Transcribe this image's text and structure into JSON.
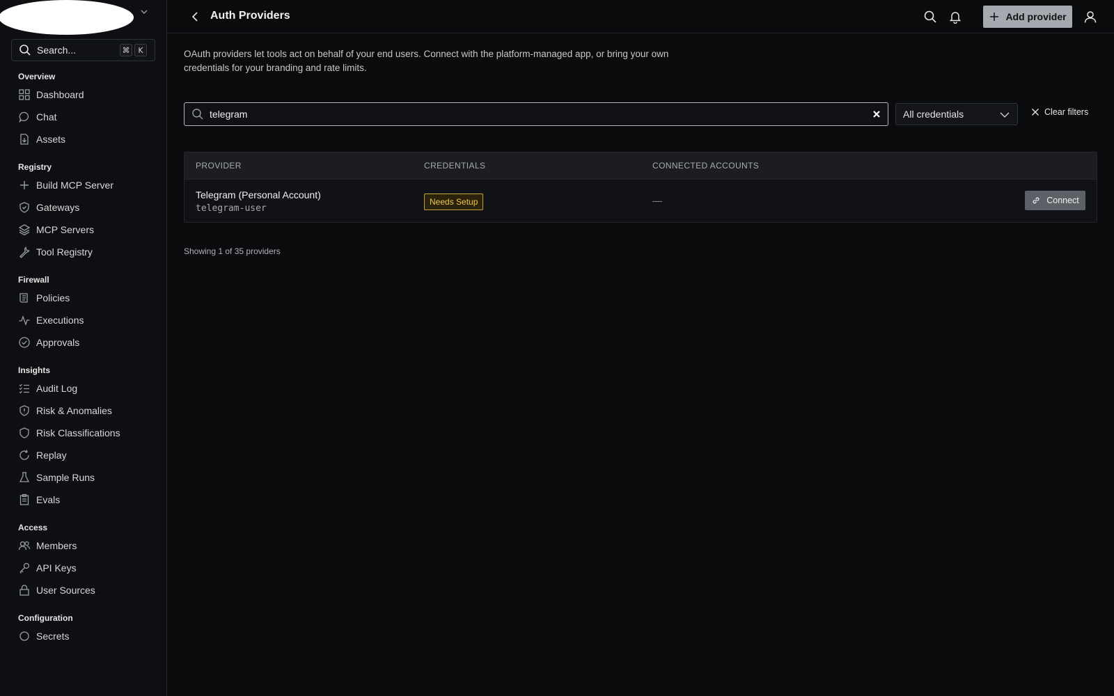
{
  "sidebar": {
    "search_label": "Search...",
    "shortcut_keys": [
      "⌘",
      "K"
    ],
    "sections": [
      {
        "title": "Overview",
        "items": [
          {
            "label": "Dashboard",
            "icon": "grid-icon"
          },
          {
            "label": "Chat",
            "icon": "chat-icon"
          },
          {
            "label": "Assets",
            "icon": "download-icon"
          }
        ]
      },
      {
        "title": "Registry",
        "items": [
          {
            "label": "Build MCP Server",
            "icon": "plus-icon"
          },
          {
            "label": "Gateways",
            "icon": "shield-check-icon"
          },
          {
            "label": "MCP Servers",
            "icon": "layers-icon"
          },
          {
            "label": "Tool Registry",
            "icon": "wrench-icon"
          }
        ]
      },
      {
        "title": "Firewall",
        "items": [
          {
            "label": "Policies",
            "icon": "scroll-icon"
          },
          {
            "label": "Executions",
            "icon": "activity-icon"
          },
          {
            "label": "Approvals",
            "icon": "check-circle-icon"
          }
        ]
      },
      {
        "title": "Insights",
        "items": [
          {
            "label": "Audit Log",
            "icon": "list-check-icon"
          },
          {
            "label": "Risk & Anomalies",
            "icon": "shield-alert-icon"
          },
          {
            "label": "Risk Classifications",
            "icon": "shield-icon"
          },
          {
            "label": "Replay",
            "icon": "refresh-icon"
          },
          {
            "label": "Sample Runs",
            "icon": "flask-icon"
          },
          {
            "label": "Evals",
            "icon": "clipboard-icon"
          }
        ]
      },
      {
        "title": "Access",
        "items": [
          {
            "label": "Members",
            "icon": "users-icon"
          },
          {
            "label": "API Keys",
            "icon": "key-icon"
          },
          {
            "label": "User Sources",
            "icon": "lock-icon"
          }
        ]
      },
      {
        "title": "Configuration",
        "items": [
          {
            "label": "Secrets",
            "icon": "secret-icon"
          }
        ]
      }
    ]
  },
  "header": {
    "title": "Auth Providers",
    "add_label": "Add provider"
  },
  "description": "OAuth providers let tools act on behalf of your end users. Connect with the platform-managed app, or bring your own credentials for your branding and rate limits.",
  "filters": {
    "search_value": "telegram",
    "credentials_select": "All credentials",
    "clear_label": "Clear filters"
  },
  "table": {
    "columns": [
      "PROVIDER",
      "CREDENTIALS",
      "CONNECTED ACCOUNTS"
    ],
    "rows": [
      {
        "name": "Telegram (Personal Account)",
        "slug": "telegram-user",
        "credentials": "Needs Setup",
        "connected": "—",
        "action": "Connect"
      }
    ]
  },
  "footer": {
    "showing": "Showing 1 of 35 providers"
  }
}
